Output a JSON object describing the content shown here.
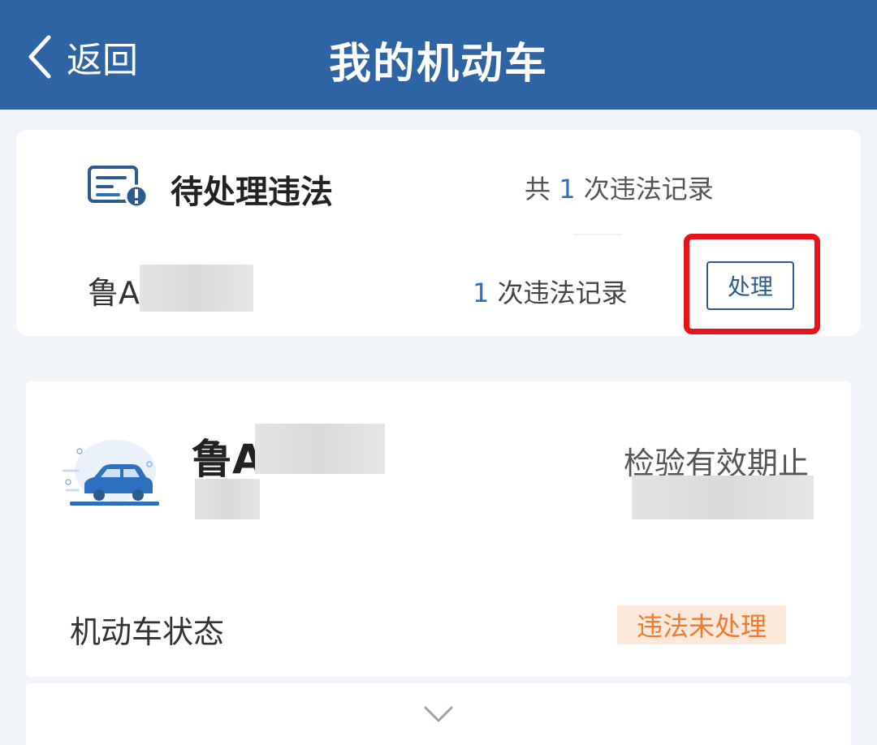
{
  "header": {
    "back_label": "返回",
    "title": "我的机动车"
  },
  "violations": {
    "title": "待处理违法",
    "total_prefix": "共",
    "total_count": "1",
    "total_suffix": "次违法记录",
    "row": {
      "plate_prefix": "鲁A",
      "count": "1",
      "count_suffix": "次违法记录",
      "action_label": "处理"
    }
  },
  "vehicle": {
    "plate_prefix": "鲁A",
    "inspection_label": "检验有效期止",
    "status_label": "机动车状态",
    "status_value": "违法未处理"
  },
  "colors": {
    "header_bg": "#2e63a4",
    "accent_blue": "#2e6fc0",
    "badge_bg": "#fde9dc",
    "badge_text": "#f07a2e",
    "highlight_red": "#e8121b"
  },
  "icons": {
    "back": "chevron-left-icon",
    "violation": "document-alert-icon",
    "car": "car-icon",
    "expand": "chevron-down-icon"
  }
}
